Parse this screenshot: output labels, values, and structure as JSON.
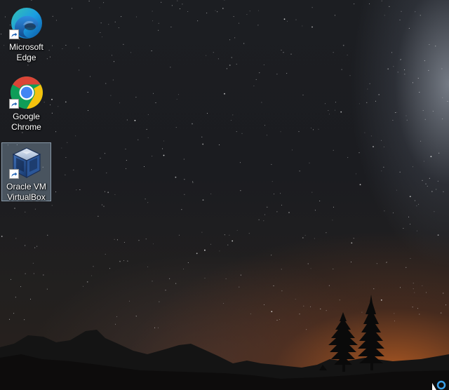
{
  "desktop": {
    "wallpaper": "night-sky-mountain-silhouette",
    "icons": [
      {
        "label_line1": "Microsoft",
        "label_line2": "Edge",
        "icon": "edge-icon",
        "shortcut": true,
        "selected": false
      },
      {
        "label_line1": "Google",
        "label_line2": "Chrome",
        "icon": "chrome-icon",
        "shortcut": true,
        "selected": false
      },
      {
        "label_line1": "Oracle VM",
        "label_line2": "VirtualBox",
        "icon": "virtualbox-icon",
        "shortcut": true,
        "selected": true
      }
    ]
  },
  "colors": {
    "edge_primary": "#1b9de2",
    "edge_secondary": "#35c1b0",
    "chrome_red": "#db4437",
    "chrome_yellow": "#f4c20d",
    "chrome_green": "#0f9d58",
    "chrome_blue": "#4285f4",
    "selection": "#96afc8"
  }
}
